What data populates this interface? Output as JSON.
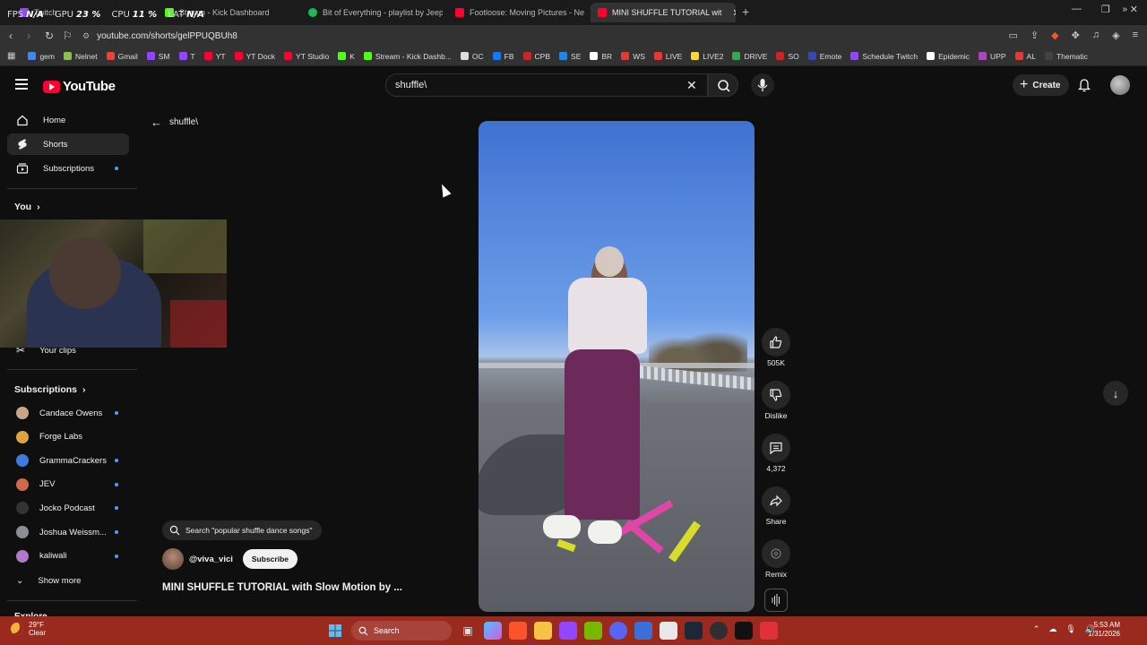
{
  "overlay": {
    "fps_label": "FPS",
    "fps_value": "N/A",
    "gpu_label": "GPU",
    "gpu_value": "23 %",
    "cpu_label": "CPU",
    "cpu_value": "11 %",
    "lat_label": "LAT",
    "lat_value": "N/A"
  },
  "tabs": [
    {
      "title": "Twitch",
      "color": "#9146ff"
    },
    {
      "title": "Stream - Kick Dashboard",
      "color": "#53fc18"
    },
    {
      "title": "Bit of Everything - playlist by Jeep W",
      "color": "#1db954"
    },
    {
      "title": "Footloose: Moving Pictures - Never G",
      "color": "#ff0033"
    },
    {
      "title": "MINI SHUFFLE TUTORIAL wit",
      "color": "#ff0033"
    }
  ],
  "url": "youtube.com/shorts/gelPPUQBUh8",
  "bookmarks": [
    {
      "label": "gem",
      "color": "#4285f4"
    },
    {
      "label": "Nelnet",
      "color": "#8bc34a"
    },
    {
      "label": "Gmail",
      "color": "#ea4335"
    },
    {
      "label": "SM",
      "color": "#9146ff"
    },
    {
      "label": "T",
      "color": "#9146ff"
    },
    {
      "label": "YT",
      "color": "#ff0033"
    },
    {
      "label": "YT Dock",
      "color": "#ff0033"
    },
    {
      "label": "YT Studio",
      "color": "#ff0033"
    },
    {
      "label": "K",
      "color": "#53fc18"
    },
    {
      "label": "Stream - Kick Dashb...",
      "color": "#53fc18"
    },
    {
      "label": "OC",
      "color": "#dddddd"
    },
    {
      "label": "FB",
      "color": "#1877f2"
    },
    {
      "label": "CPB",
      "color": "#c62828"
    },
    {
      "label": "SE",
      "color": "#1e88e5"
    },
    {
      "label": "BR",
      "color": "#ffffff"
    },
    {
      "label": "WS",
      "color": "#e53935"
    },
    {
      "label": "LIVE",
      "color": "#e53935"
    },
    {
      "label": "LIVE2",
      "color": "#fdd835"
    },
    {
      "label": "DRIVE",
      "color": "#34a853"
    },
    {
      "label": "SO",
      "color": "#c62828"
    },
    {
      "label": "Emote",
      "color": "#3949ab"
    },
    {
      "label": "Schedule Twitch",
      "color": "#9146ff"
    },
    {
      "label": "Epidemic",
      "color": "#ffffff"
    },
    {
      "label": "UPP",
      "color": "#ab47bc"
    },
    {
      "label": "AL",
      "color": "#e53935"
    },
    {
      "label": "Thematic",
      "color": "#424242"
    }
  ],
  "header": {
    "logo_text": "YouTube",
    "search_value": "shuffle\\",
    "create_label": "Create"
  },
  "sidebar": {
    "home": "Home",
    "shorts": "Shorts",
    "subscriptions": "Subscriptions",
    "you": "You",
    "your_clips": "Your clips",
    "subs_heading": "Subscriptions",
    "channels": [
      {
        "name": "Candace Owens",
        "color": "#c9a68a"
      },
      {
        "name": "Forge Labs",
        "color": "#d9a441"
      },
      {
        "name": "GrammaCrackers",
        "color": "#3d7be0"
      },
      {
        "name": "JEV",
        "color": "#d0684a"
      },
      {
        "name": "Jocko Podcast",
        "color": "#333333"
      },
      {
        "name": "Joshua Weissm...",
        "color": "#8a8f96"
      },
      {
        "name": "kaliwali",
        "color": "#b07ac8"
      }
    ],
    "show_more": "Show more",
    "explore": "Explore"
  },
  "short": {
    "back_title": "shuffle\\",
    "search_chip": "Search \"popular shuffle dance songs\"",
    "channel": "@viva_vici",
    "subscribe": "Subscribe",
    "title": "MINI SHUFFLE TUTORIAL with Slow Motion by ...",
    "likes": "505K",
    "dislike": "Dislike",
    "comments": "4,372",
    "share": "Share",
    "remix": "Remix"
  },
  "taskbar": {
    "temp": "29°F",
    "condition": "Clear",
    "search": "Search",
    "time": "5:53 AM",
    "date": "1/31/2026"
  }
}
